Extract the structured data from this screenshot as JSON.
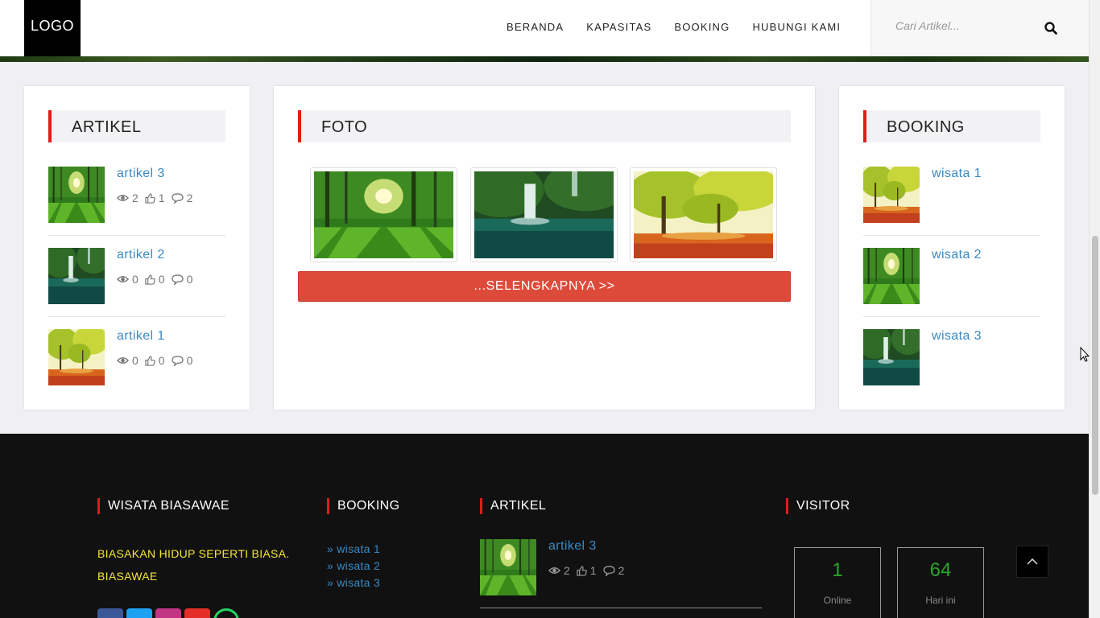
{
  "header": {
    "logo": "LOGO",
    "nav": [
      "BERANDA",
      "KAPASITAS",
      "BOOKING",
      "HUBUNGI KAMI"
    ],
    "search_placeholder": "Cari Artikel..."
  },
  "artikel_panel": {
    "title": "ARTIKEL",
    "items": [
      {
        "title": "artikel 3",
        "views": "2",
        "likes": "1",
        "comments": "2",
        "image": "forest-sun"
      },
      {
        "title": "artikel 2",
        "views": "0",
        "likes": "0",
        "comments": "0",
        "image": "waterfall"
      },
      {
        "title": "artikel 1",
        "views": "0",
        "likes": "0",
        "comments": "0",
        "image": "autumn-tree"
      }
    ]
  },
  "foto_panel": {
    "title": "FOTO",
    "photos": [
      "forest-sun",
      "waterfall",
      "autumn-tree"
    ],
    "more_label": "...SELENGKAPNYA >>"
  },
  "booking_panel": {
    "title": "BOOKING",
    "items": [
      {
        "title": "wisata 1",
        "image": "autumn-tree"
      },
      {
        "title": "wisata 2",
        "image": "forest-sun"
      },
      {
        "title": "wisata 3",
        "image": "waterfall"
      }
    ]
  },
  "footer": {
    "about_title": "WISATA BIASAWAE",
    "tagline": "BIASAKAN HIDUP SEPERTI BIASA. BIASAWAE",
    "booking_title": "BOOKING",
    "booking_links": [
      "» wisata 1",
      "» wisata 2",
      "» wisata 3"
    ],
    "artikel_title": "ARTIKEL",
    "artikel_item": {
      "title": "artikel 3",
      "views": "2",
      "likes": "1",
      "comments": "2"
    },
    "visitor_title": "VISITOR",
    "visitor": [
      {
        "value": "1",
        "label": "Online"
      },
      {
        "value": "64",
        "label": "Hari ini"
      }
    ],
    "social": [
      "facebook-icon",
      "twitter-icon",
      "instagram-icon",
      "youtube-icon",
      "whatsapp-icon"
    ]
  },
  "colors": {
    "accent_red": "#e31b1b",
    "link_blue": "#3a8ac4",
    "button_red": "#de4a3a",
    "tagline_yellow": "#f5e634",
    "visitor_green": "#2aa62a"
  }
}
